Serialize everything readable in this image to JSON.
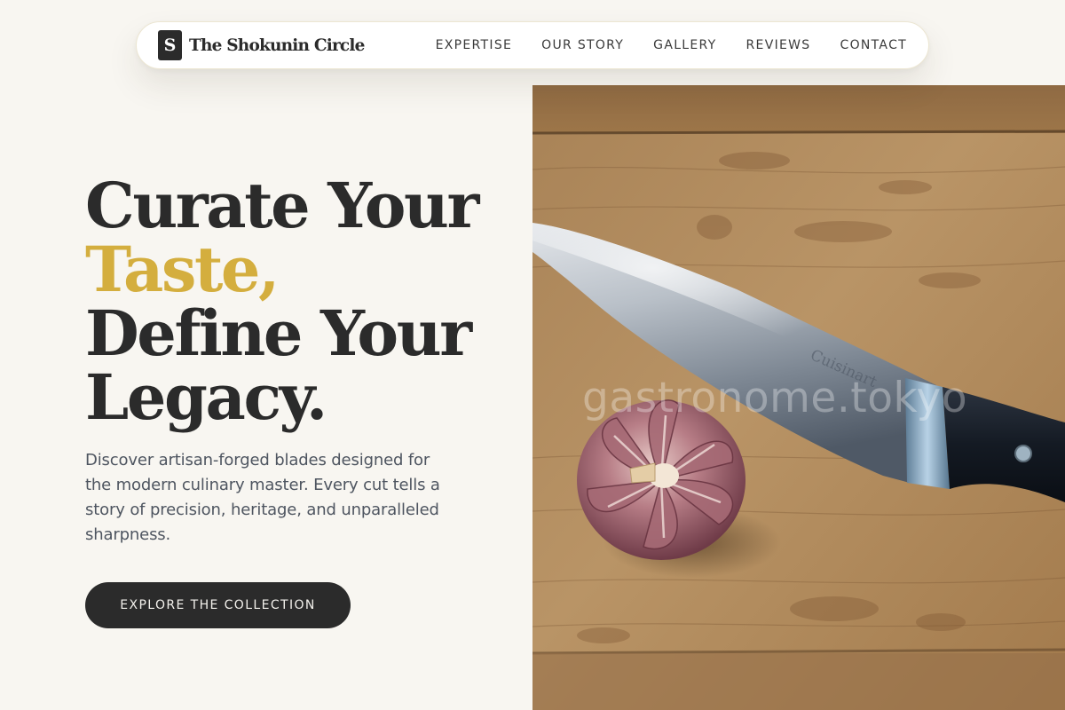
{
  "brand": {
    "mark": "S",
    "name": "The Shokunin Circle"
  },
  "nav": {
    "links": [
      "EXPERTISE",
      "OUR STORY",
      "GALLERY",
      "REVIEWS",
      "CONTACT"
    ]
  },
  "hero": {
    "headline": {
      "line1": "Curate Your",
      "line2": "Taste,",
      "line3": "Define Your",
      "line4": "Legacy."
    },
    "description": "Discover artisan-forged blades designed for the modern culinary master. Every cut tells a story of precision, heritage, and unparalleled sharpness.",
    "cta_label": "EXPLORE THE COLLECTION"
  },
  "image": {
    "watermark": "gastronome.tokyo",
    "blade_engraving": "Cuisinart"
  },
  "colors": {
    "background": "#f8f6f1",
    "text_dark": "#2b2b2b",
    "accent_gold": "#d4ae3e",
    "body_text": "#4e5560"
  }
}
